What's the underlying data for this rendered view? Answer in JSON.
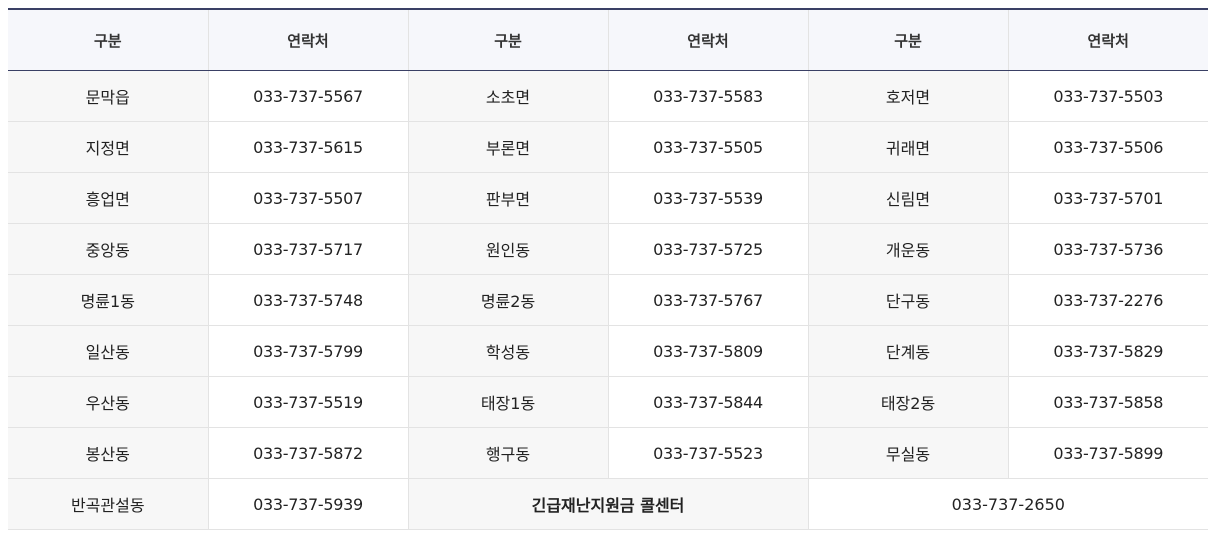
{
  "table": {
    "headers": [
      "구분",
      "연락처",
      "구분",
      "연락처",
      "구분",
      "연락처"
    ],
    "rows": [
      [
        {
          "area": "문막읍",
          "phone": "033-737-5567"
        },
        {
          "area": "소초면",
          "phone": "033-737-5583"
        },
        {
          "area": "호저면",
          "phone": "033-737-5503"
        }
      ],
      [
        {
          "area": "지정면",
          "phone": "033-737-5615"
        },
        {
          "area": "부론면",
          "phone": "033-737-5505"
        },
        {
          "area": "귀래면",
          "phone": "033-737-5506"
        }
      ],
      [
        {
          "area": "흥업면",
          "phone": "033-737-5507"
        },
        {
          "area": "판부면",
          "phone": "033-737-5539"
        },
        {
          "area": "신림면",
          "phone": "033-737-5701"
        }
      ],
      [
        {
          "area": "중앙동",
          "phone": "033-737-5717"
        },
        {
          "area": "원인동",
          "phone": "033-737-5725"
        },
        {
          "area": "개운동",
          "phone": "033-737-5736"
        }
      ],
      [
        {
          "area": "명륜1동",
          "phone": "033-737-5748"
        },
        {
          "area": "명륜2동",
          "phone": "033-737-5767"
        },
        {
          "area": "단구동",
          "phone": "033-737-2276"
        }
      ],
      [
        {
          "area": "일산동",
          "phone": "033-737-5799"
        },
        {
          "area": "학성동",
          "phone": "033-737-5809"
        },
        {
          "area": "단계동",
          "phone": "033-737-5829"
        }
      ],
      [
        {
          "area": "우산동",
          "phone": "033-737-5519"
        },
        {
          "area": "태장1동",
          "phone": "033-737-5844"
        },
        {
          "area": "태장2동",
          "phone": "033-737-5858"
        }
      ],
      [
        {
          "area": "봉산동",
          "phone": "033-737-5872"
        },
        {
          "area": "행구동",
          "phone": "033-737-5523"
        },
        {
          "area": "무실동",
          "phone": "033-737-5899"
        }
      ]
    ],
    "last_row": {
      "area": "반곡관설동",
      "phone": "033-737-5939",
      "callcenter_label": "긴급재난지원금 콜센터",
      "callcenter_phone": "033-737-2650"
    }
  },
  "colors": {
    "header_border": "#3a4065",
    "header_bg": "#f6f7fb",
    "area_bg": "#f7f7f7",
    "callcenter_text": "#e60012"
  }
}
